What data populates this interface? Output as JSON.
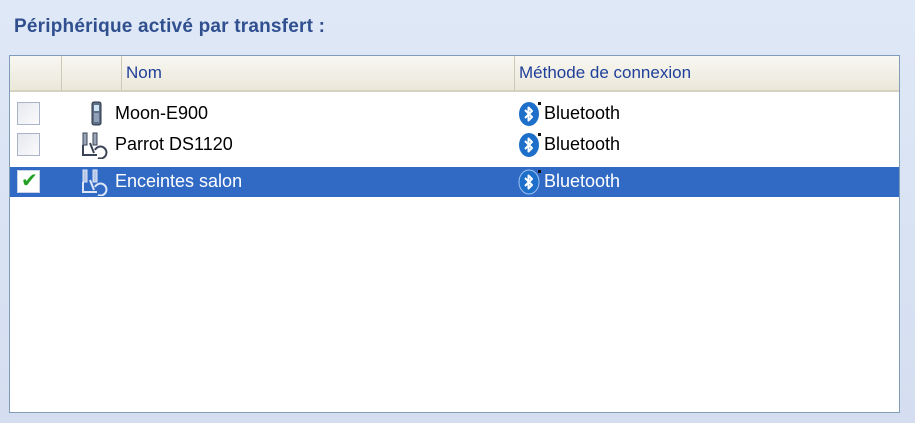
{
  "panel": {
    "title": "Périphérique activé par transfert :"
  },
  "table": {
    "columns": {
      "check": "",
      "icon": "",
      "name": "Nom",
      "method": "Méthode de connexion"
    },
    "rows": [
      {
        "checked": false,
        "selected": false,
        "icon": "phone-icon",
        "name": "Moon-E900",
        "method": "Bluetooth",
        "method_icon": "bluetooth-icon"
      },
      {
        "checked": false,
        "selected": false,
        "icon": "headset-device-icon",
        "name": "Parrot DS1120",
        "method": "Bluetooth",
        "method_icon": "bluetooth-icon"
      },
      {
        "checked": true,
        "selected": true,
        "icon": "headset-device-icon",
        "name": "Enceintes salon",
        "method": "Bluetooth",
        "method_icon": "bluetooth-icon"
      }
    ]
  },
  "colors": {
    "selection": "#316ac5",
    "title": "#2f4f8f",
    "header_text": "#1f3f9a",
    "check_green": "#21a121"
  }
}
